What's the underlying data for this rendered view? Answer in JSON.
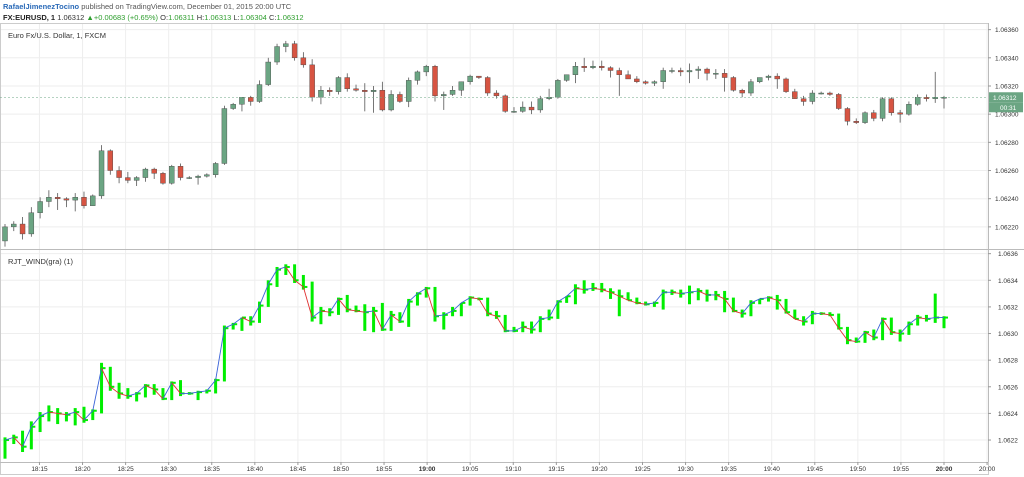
{
  "header": {
    "author": "RafaelJimenezTocino",
    "published": "published on TradingView.com, December 01, 2015 20:00 UTC",
    "symbol": "FX:EURUSD, 1",
    "last": "1.06312",
    "arrow": "▲",
    "change": "+0.00683 (+0.65%)",
    "o_label": "O:",
    "o_value": "1.06311",
    "h_label": "H:",
    "h_value": "1.06313",
    "l_label": "L:",
    "l_value": "1.06304",
    "c_label": "C:",
    "c_value": "1.06312"
  },
  "colors": {
    "up_candle": "#6ba583",
    "down_candle": "#d75442",
    "wind_bar": "#00ee00",
    "line_up": "#3a63d8",
    "line_down": "#e03030",
    "grid": "#eeeeee",
    "price_tag": "#6ba583"
  },
  "chart_data": [
    {
      "type": "candlestick",
      "title": "Euro Fx/U.S. Dollar, 1, FXCM",
      "price_label": "1.06312",
      "countdown_label": "00:31",
      "y_ticks": [
        "1.06360",
        "1.06340",
        "1.06320",
        "1.06300",
        "1.06280",
        "1.06260",
        "1.06240",
        "1.06220"
      ],
      "ylim": [
        1.06205,
        1.06364
      ],
      "x_ticks": [
        "18:15",
        "18:20",
        "18:25",
        "18:30",
        "18:35",
        "18:40",
        "18:45",
        "18:50",
        "18:55",
        "19:00",
        "19:05",
        "19:10",
        "19:15",
        "19:20",
        "19:25",
        "19:30",
        "19:35",
        "19:40",
        "19:45",
        "19:50",
        "19:55",
        "20:00",
        "20:00"
      ],
      "x_start": "18:11",
      "x_end": "20:00",
      "candles": [
        [
          1.0621,
          1.06222,
          1.06206,
          1.0622
        ],
        [
          1.0622,
          1.06224,
          1.06217,
          1.06222
        ],
        [
          1.06222,
          1.06227,
          1.06211,
          1.06215
        ],
        [
          1.06215,
          1.06234,
          1.06213,
          1.0623
        ],
        [
          1.0623,
          1.06241,
          1.06226,
          1.06238
        ],
        [
          1.06238,
          1.06246,
          1.06234,
          1.06241
        ],
        [
          1.06241,
          1.06244,
          1.06232,
          1.0624
        ],
        [
          1.0624,
          1.06241,
          1.06234,
          1.06239
        ],
        [
          1.06239,
          1.06244,
          1.06231,
          1.06241
        ],
        [
          1.06241,
          1.06245,
          1.06233,
          1.06235
        ],
        [
          1.06235,
          1.06243,
          1.06235,
          1.06242
        ],
        [
          1.06242,
          1.06278,
          1.0624,
          1.06274
        ],
        [
          1.06274,
          1.06275,
          1.06257,
          1.0626
        ],
        [
          1.0626,
          1.06263,
          1.06251,
          1.06255
        ],
        [
          1.06255,
          1.06259,
          1.06251,
          1.06253
        ],
        [
          1.06253,
          1.06256,
          1.06249,
          1.06255
        ],
        [
          1.06255,
          1.06262,
          1.06252,
          1.06261
        ],
        [
          1.06261,
          1.06262,
          1.06254,
          1.06258
        ],
        [
          1.06258,
          1.06259,
          1.0625,
          1.06251
        ],
        [
          1.06251,
          1.06264,
          1.0625,
          1.06263
        ],
        [
          1.06263,
          1.06265,
          1.06253,
          1.06255
        ],
        [
          1.06255,
          1.06256,
          1.06254,
          1.06255
        ],
        [
          1.06255,
          1.06257,
          1.0625,
          1.06256
        ],
        [
          1.06256,
          1.06258,
          1.06255,
          1.06257
        ],
        [
          1.06257,
          1.06266,
          1.06255,
          1.06265
        ],
        [
          1.06265,
          1.06306,
          1.06264,
          1.06304
        ],
        [
          1.06304,
          1.06308,
          1.06303,
          1.06307
        ],
        [
          1.06307,
          1.06312,
          1.06302,
          1.06312
        ],
        [
          1.06312,
          1.06313,
          1.06306,
          1.06309
        ],
        [
          1.06309,
          1.06324,
          1.06308,
          1.06321
        ],
        [
          1.06321,
          1.0634,
          1.0632,
          1.06337
        ],
        [
          1.06337,
          1.0635,
          1.06335,
          1.06348
        ],
        [
          1.06348,
          1.06352,
          1.06344,
          1.0635
        ],
        [
          1.0635,
          1.06352,
          1.06338,
          1.0634
        ],
        [
          1.0634,
          1.06344,
          1.06333,
          1.06335
        ],
        [
          1.06335,
          1.06339,
          1.06309,
          1.06312
        ],
        [
          1.06312,
          1.0632,
          1.06307,
          1.06317
        ],
        [
          1.06317,
          1.06319,
          1.06313,
          1.06316
        ],
        [
          1.06316,
          1.06327,
          1.06314,
          1.06326
        ],
        [
          1.06326,
          1.06329,
          1.06316,
          1.06318
        ],
        [
          1.06318,
          1.06321,
          1.06316,
          1.06317
        ],
        [
          1.06317,
          1.06322,
          1.06302,
          1.06316
        ],
        [
          1.06316,
          1.0632,
          1.06301,
          1.06317
        ],
        [
          1.06317,
          1.06323,
          1.06302,
          1.06303
        ],
        [
          1.06303,
          1.06317,
          1.06302,
          1.06314
        ],
        [
          1.06314,
          1.06316,
          1.06308,
          1.06309
        ],
        [
          1.06309,
          1.06326,
          1.06305,
          1.06324
        ],
        [
          1.06324,
          1.06331,
          1.06321,
          1.0633
        ],
        [
          1.0633,
          1.06335,
          1.06327,
          1.06334
        ],
        [
          1.06334,
          1.06335,
          1.06309,
          1.06313
        ],
        [
          1.06313,
          1.06316,
          1.06303,
          1.06314
        ],
        [
          1.06314,
          1.0632,
          1.06313,
          1.06317
        ],
        [
          1.06317,
          1.06323,
          1.06313,
          1.06323
        ],
        [
          1.06323,
          1.06328,
          1.06321,
          1.06327
        ],
        [
          1.06327,
          1.06327,
          1.06325,
          1.06326
        ],
        [
          1.06326,
          1.06327,
          1.06313,
          1.06315
        ],
        [
          1.06315,
          1.06317,
          1.06311,
          1.06313
        ],
        [
          1.06313,
          1.06314,
          1.06301,
          1.06302
        ],
        [
          1.06302,
          1.06305,
          1.06301,
          1.06302
        ],
        [
          1.06302,
          1.06309,
          1.06301,
          1.06305
        ],
        [
          1.06305,
          1.06309,
          1.063,
          1.06303
        ],
        [
          1.06303,
          1.06313,
          1.06301,
          1.06311
        ],
        [
          1.06311,
          1.06318,
          1.0631,
          1.06312
        ],
        [
          1.06312,
          1.06325,
          1.06311,
          1.06324
        ],
        [
          1.06324,
          1.06328,
          1.06323,
          1.06328
        ],
        [
          1.06328,
          1.06337,
          1.06322,
          1.06334
        ],
        [
          1.06334,
          1.0634,
          1.0633,
          1.06333
        ],
        [
          1.06333,
          1.06338,
          1.06332,
          1.06334
        ],
        [
          1.06334,
          1.06338,
          1.06331,
          1.06333
        ],
        [
          1.06333,
          1.06334,
          1.06326,
          1.06331
        ],
        [
          1.06331,
          1.06333,
          1.06313,
          1.06328
        ],
        [
          1.06328,
          1.06331,
          1.06325,
          1.06325
        ],
        [
          1.06325,
          1.06327,
          1.06322,
          1.06323
        ],
        [
          1.06323,
          1.06324,
          1.06321,
          1.06322
        ],
        [
          1.06322,
          1.06324,
          1.0632,
          1.06323
        ],
        [
          1.06323,
          1.06333,
          1.06318,
          1.06331
        ],
        [
          1.06331,
          1.06333,
          1.06329,
          1.06331
        ],
        [
          1.06331,
          1.06333,
          1.06327,
          1.0633
        ],
        [
          1.0633,
          1.06336,
          1.06322,
          1.06331
        ],
        [
          1.06331,
          1.06334,
          1.06325,
          1.06332
        ],
        [
          1.06332,
          1.06333,
          1.06324,
          1.06329
        ],
        [
          1.06329,
          1.06332,
          1.06325,
          1.06329
        ],
        [
          1.06329,
          1.06332,
          1.06316,
          1.06326
        ],
        [
          1.06326,
          1.06327,
          1.06316,
          1.06317
        ],
        [
          1.06317,
          1.06318,
          1.06312,
          1.06315
        ],
        [
          1.06315,
          1.06325,
          1.06313,
          1.06323
        ],
        [
          1.06323,
          1.06326,
          1.06322,
          1.06326
        ],
        [
          1.06326,
          1.06328,
          1.06324,
          1.06327
        ],
        [
          1.06327,
          1.06329,
          1.06318,
          1.06325
        ],
        [
          1.06325,
          1.06326,
          1.06315,
          1.06316
        ],
        [
          1.06316,
          1.06318,
          1.06311,
          1.06311
        ],
        [
          1.06311,
          1.06313,
          1.06306,
          1.06309
        ],
        [
          1.06309,
          1.06317,
          1.06307,
          1.06315
        ],
        [
          1.06315,
          1.06316,
          1.06314,
          1.06315
        ],
        [
          1.06315,
          1.06316,
          1.06313,
          1.06314
        ],
        [
          1.06314,
          1.06315,
          1.06303,
          1.06304
        ],
        [
          1.06304,
          1.06305,
          1.06292,
          1.06295
        ],
        [
          1.06295,
          1.06297,
          1.06293,
          1.06294
        ],
        [
          1.06294,
          1.06302,
          1.06293,
          1.06301
        ],
        [
          1.06301,
          1.06303,
          1.06295,
          1.06297
        ],
        [
          1.06297,
          1.06312,
          1.06295,
          1.06311
        ],
        [
          1.06311,
          1.06312,
          1.06299,
          1.06301
        ],
        [
          1.06301,
          1.06303,
          1.06294,
          1.063
        ],
        [
          1.063,
          1.06309,
          1.06299,
          1.06307
        ],
        [
          1.06307,
          1.06314,
          1.06306,
          1.06312
        ],
        [
          1.06312,
          1.06314,
          1.06309,
          1.06311
        ],
        [
          1.06311,
          1.0633,
          1.06308,
          1.06312
        ],
        [
          1.06312,
          1.06313,
          1.06304,
          1.06312
        ]
      ]
    },
    {
      "type": "line",
      "title": "RJT_WIND(gra) (1)",
      "y_ticks": [
        "1.0636",
        "1.0634",
        "1.0632",
        "1.0630",
        "1.0628",
        "1.0626",
        "1.0624",
        "1.0622"
      ],
      "ylim": [
        1.06205,
        1.06362
      ],
      "series": [
        {
          "name": "",
          "source": "close"
        }
      ]
    }
  ]
}
